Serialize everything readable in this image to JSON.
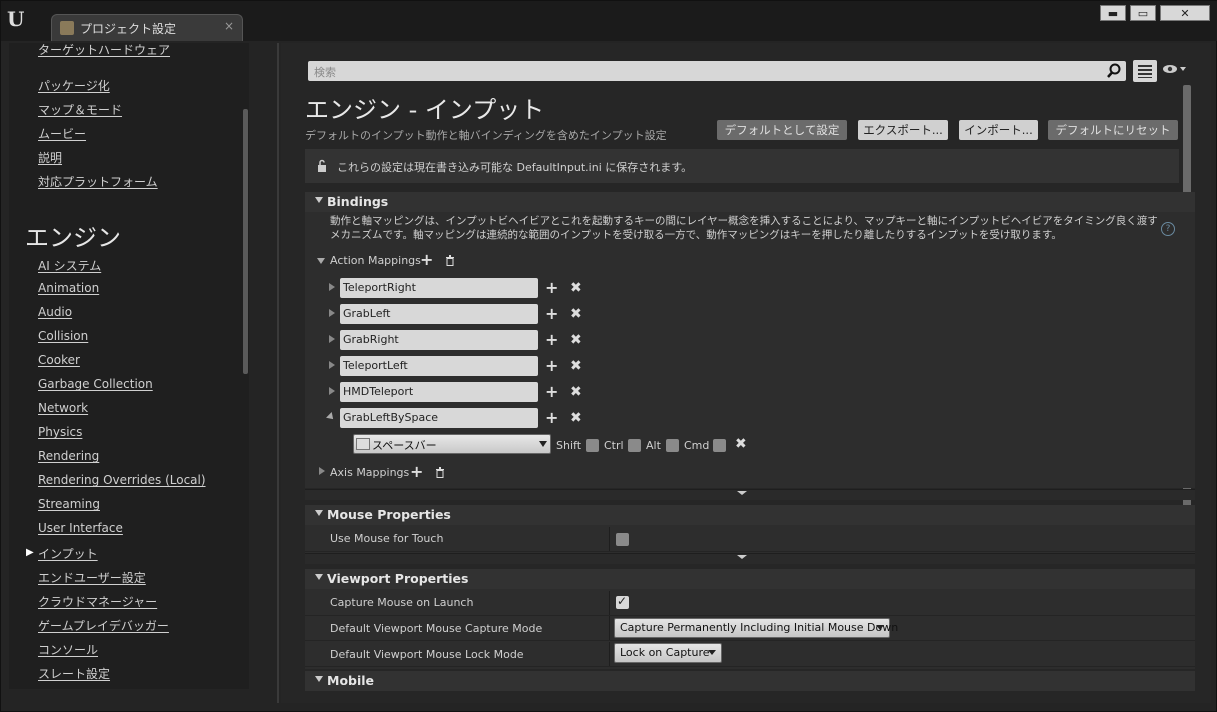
{
  "window": {
    "tab_title": "プロジェクト設定",
    "tab_close": "×",
    "min_glyph": "▬",
    "max_glyph": "▭",
    "close_glyph": "✕"
  },
  "sidebar": {
    "cut_item": "ターゲットハードウェア",
    "items_top": [
      "パッケージ化",
      "マップ＆モード",
      "ムービー",
      "説明",
      "対応プラットフォーム"
    ],
    "heading": "エンジン",
    "items": [
      "AI システム",
      "Animation",
      "Audio",
      "Collision",
      "Cooker",
      "Garbage Collection",
      "Network",
      "Physics",
      "Rendering",
      "Rendering Overrides (Local)",
      "Streaming",
      "User Interface",
      "インプット",
      "エンドユーザー設定",
      "クラウドマネージャー",
      "ゲームプレイデバッガー",
      "コンソール",
      "スレート設定"
    ],
    "selected": "インプット"
  },
  "search": {
    "placeholder": "検索"
  },
  "page": {
    "title": "エンジン - インプット",
    "subtitle": "デフォルトのインプット動作と軸バインディングを含めたインプット設定",
    "buttons": {
      "set_default": "デフォルトとして設定",
      "export": "エクスポート...",
      "import": "インポート...",
      "reset": "デフォルトにリセット"
    },
    "info": "これらの設定は現在書き込み可能な DefaultInput.ini に保存されます。"
  },
  "bindings": {
    "title": "Bindings",
    "description": "動作と軸マッピングは、インプットビヘイビアとこれを起動するキーの間にレイヤー概念を挿入することにより、マップキーと軸にインプットビヘイビアをタイミング良く渡すメカニズムです。軸マッピングは連続的な範囲のインプットを受け取る一方で、動作マッピングはキーを押したり離したりするインプットを受け取ります。",
    "action_mappings_label": "Action Mappings",
    "actions": [
      "TeleportRight",
      "GrabLeft",
      "GrabRight",
      "TeleportLeft",
      "HMDTeleport",
      "GrabLeftBySpace"
    ],
    "expanded_key": "スペースバー",
    "modifiers": [
      "Shift",
      "Ctrl",
      "Alt",
      "Cmd"
    ],
    "axis_mappings_label": "Axis Mappings"
  },
  "mouse": {
    "title": "Mouse Properties",
    "use_mouse_for_touch": "Use Mouse for Touch",
    "use_mouse_for_touch_checked": false
  },
  "viewport": {
    "title": "Viewport Properties",
    "capture_on_launch": "Capture Mouse on Launch",
    "capture_on_launch_checked": true,
    "capture_mode_label": "Default Viewport Mouse Capture Mode",
    "capture_mode_value": "Capture Permanently Including Initial Mouse Down",
    "lock_mode_label": "Default Viewport Mouse Lock Mode",
    "lock_mode_value": "Lock on Capture"
  },
  "mobile": {
    "title": "Mobile"
  }
}
